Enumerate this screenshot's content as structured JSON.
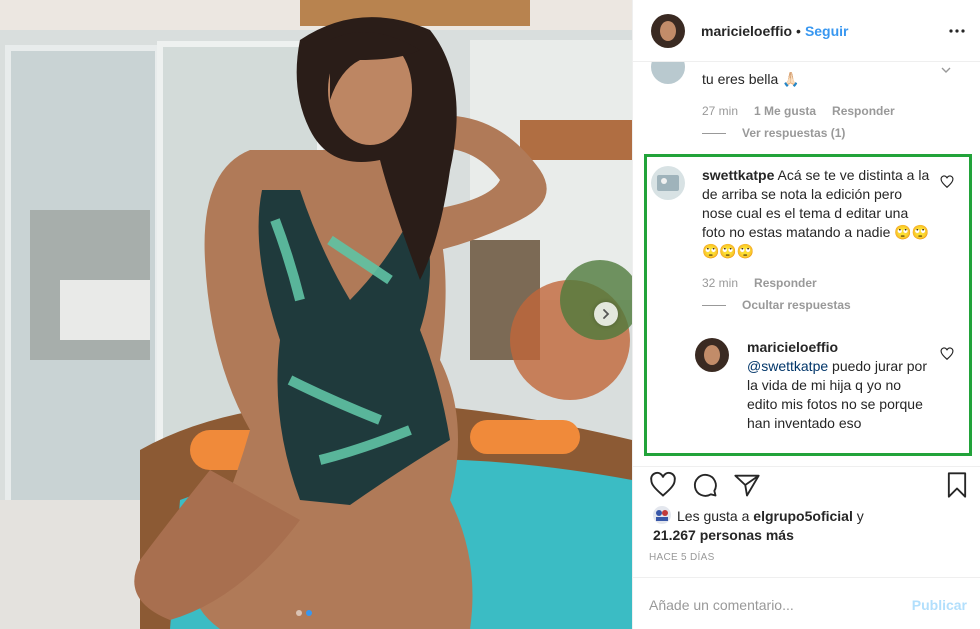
{
  "post": {
    "username": "maricieloeffio",
    "separator": "•",
    "follow_label": "Seguir",
    "more_icon": "more-horizontal-icon"
  },
  "comments": [
    {
      "username": "",
      "text": "tu eres bella 🙏🏻",
      "time": "27 min",
      "likes": "1 Me gusta",
      "reply_label": "Responder",
      "replies_link": "Ver respuestas (1)"
    },
    {
      "username": "swettkatpe",
      "text": "Acá se te ve distinta a la de arriba se nota la edición pero nose cual es el tema d editar una foto no estas matando a nadie 🙄🙄🙄🙄🙄",
      "time": "32 min",
      "reply_label": "Responder",
      "replies_link": "Ocultar respuestas",
      "reply": {
        "username": "maricieloeffio",
        "mention": "@swettkatpe",
        "text": "puedo jurar por la vida de mi hija q yo no edito mis fotos no se porque han inventado eso"
      }
    }
  ],
  "likes": {
    "prefix": "Les gusta a",
    "user": "elgrupo5oficial",
    "conj": "y",
    "count": "21.267 personas más"
  },
  "time_ago": "HACE 5 DÍAS",
  "add_comment": {
    "placeholder": "Añade un comentario...",
    "publish_label": "Publicar"
  },
  "carousel": {
    "current_index": 1,
    "total": 2
  },
  "colors": {
    "link_blue": "#3897f0",
    "highlight": "#22a33a",
    "publish_disabled": "#b2dffc"
  }
}
